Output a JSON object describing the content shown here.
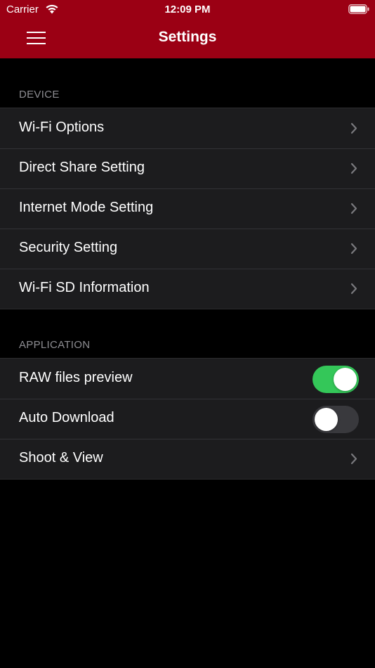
{
  "status_bar": {
    "carrier": "Carrier",
    "time": "12:09 PM"
  },
  "header": {
    "title": "Settings",
    "background": "#9b0014"
  },
  "sections": {
    "device": {
      "title": "DEVICE",
      "items": [
        {
          "label": "Wi-Fi Options"
        },
        {
          "label": "Direct Share Setting"
        },
        {
          "label": "Internet Mode Setting"
        },
        {
          "label": "Security Setting"
        },
        {
          "label": "Wi-Fi SD Information"
        }
      ]
    },
    "application": {
      "title": "APPLICATION",
      "items": [
        {
          "label": "RAW files preview",
          "toggle": true
        },
        {
          "label": "Auto Download",
          "toggle": false
        },
        {
          "label": "Shoot & View"
        }
      ]
    }
  },
  "colors": {
    "toggle_on": "#34c759",
    "toggle_off": "#39393d"
  }
}
